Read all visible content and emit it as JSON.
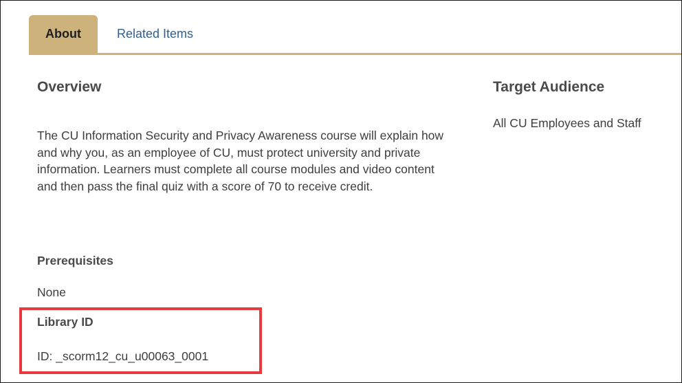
{
  "tabs": [
    {
      "label": "About",
      "active": true
    },
    {
      "label": "Related Items",
      "active": false
    }
  ],
  "overview": {
    "heading": "Overview",
    "description": "The CU Information Security and Privacy Awareness course will explain how and why you, as an employee of CU, must protect university and private information. Learners must complete all course modules and video content and then pass the final quiz with a score of 70 to receive credit."
  },
  "prerequisites": {
    "label": "Prerequisites",
    "value": "None"
  },
  "library": {
    "label": "Library ID",
    "value": "ID: _scorm12_cu_u00063_0001"
  },
  "target_audience": {
    "heading": "Target Audience",
    "value": "All CU Employees and Staff"
  },
  "colors": {
    "tab_accent": "#cdb27c",
    "link": "#2f5f92",
    "highlight": "#e8393f"
  }
}
